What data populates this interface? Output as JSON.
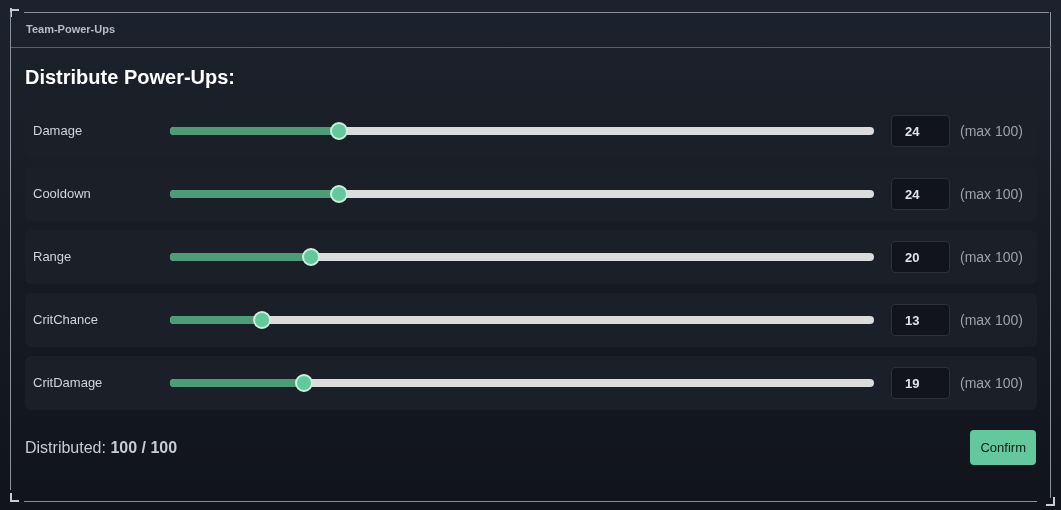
{
  "panel": {
    "header": "Team-Power-Ups",
    "title": "Distribute Power-Ups:"
  },
  "stats": [
    {
      "label": "Damage",
      "level": 0.24,
      "value": "24",
      "max": "(max 100)"
    },
    {
      "label": "Cooldown",
      "level": 0.24,
      "value": "24",
      "max": "(max 100)"
    },
    {
      "label": "Range",
      "level": 0.2,
      "value": "20",
      "max": "(max 100)"
    },
    {
      "label": "CritChance",
      "level": 0.13,
      "value": "13",
      "max": "(max 100)"
    },
    {
      "label": "CritDamage",
      "level": 0.19,
      "value": "19",
      "max": "(max 100)"
    }
  ],
  "footer": {
    "summary": "Distributed: **100 / 100**",
    "button": "Confirm"
  }
}
